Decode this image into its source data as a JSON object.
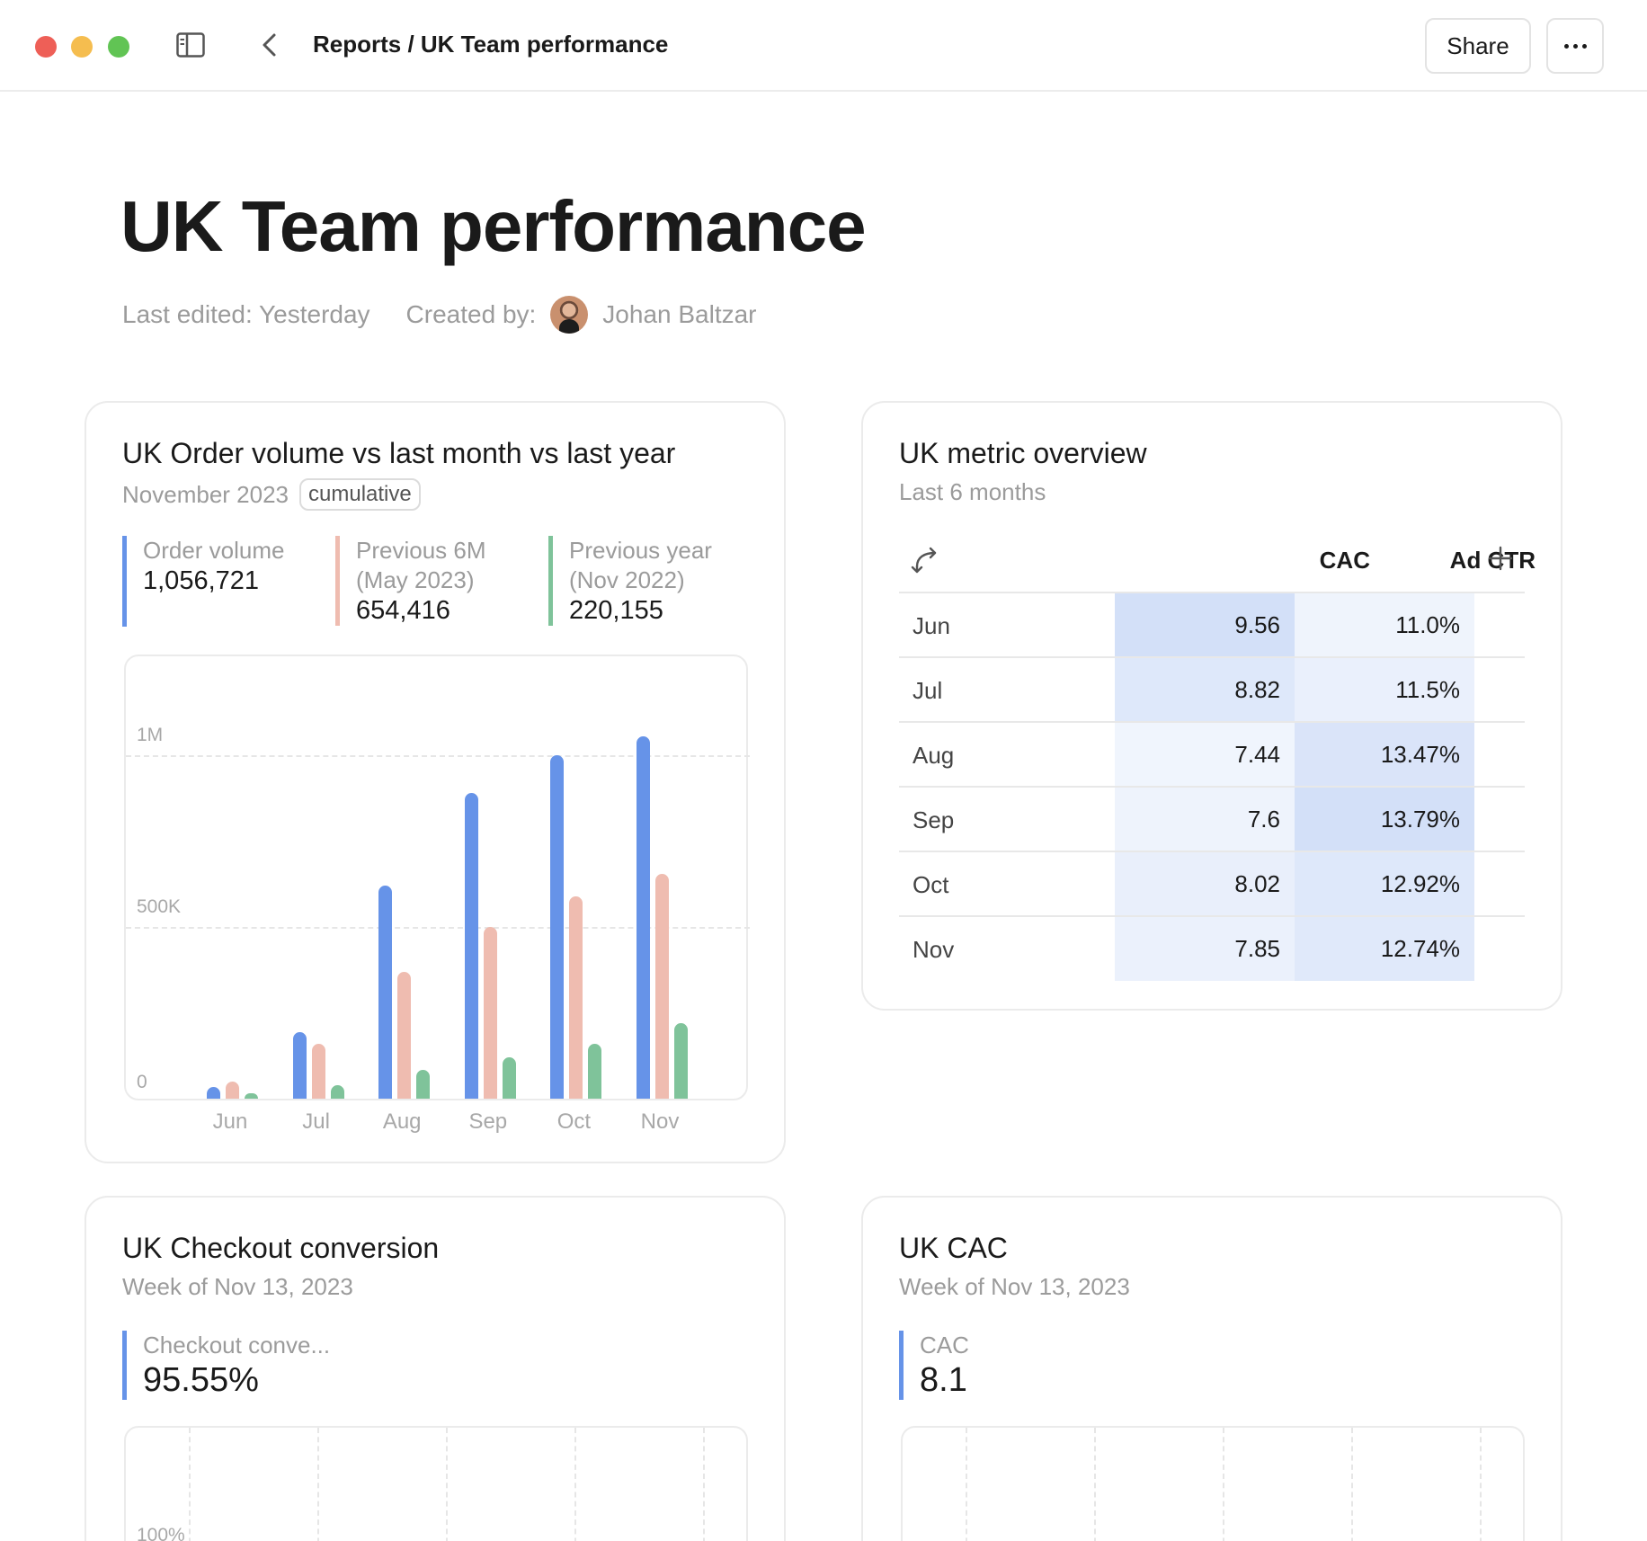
{
  "window": {
    "breadcrumb": "Reports / UK Team performance",
    "share_label": "Share",
    "icons": [
      "close-dot",
      "minimize-dot",
      "maximize-dot",
      "sidebar-toggle-icon",
      "chevron-left-icon",
      "ellipsis-icon"
    ]
  },
  "page": {
    "title": "UK Team performance",
    "last_edited": "Last edited: Yesterday",
    "created_by_label": "Created by:",
    "author": "Johan Baltzar"
  },
  "order_card": {
    "title": "UK Order volume vs last month vs last year",
    "subtitle": "November 2023",
    "badge": "cumulative",
    "kpis": [
      {
        "label": "Order volume",
        "value": "1,056,721",
        "color": "#6693e8"
      },
      {
        "label": "Previous 6M",
        "label2": "(May 2023)",
        "value": "654,416",
        "color": "#efbcb0"
      },
      {
        "label": "Previous year",
        "label2": "(Nov 2022)",
        "value": "220,155",
        "color": "#7fc39a"
      }
    ]
  },
  "chart_data": {
    "type": "bar",
    "categories": [
      "Jun",
      "Jul",
      "Aug",
      "Sep",
      "Oct",
      "Nov"
    ],
    "series": [
      {
        "values": [
          35000,
          195000,
          620000,
          890000,
          1000000,
          1056721
        ],
        "color": "#6693e8"
      },
      {
        "values": [
          50000,
          160000,
          370000,
          500000,
          590000,
          654416
        ],
        "color": "#efbcb0"
      },
      {
        "values": [
          15000,
          40000,
          85000,
          120000,
          160000,
          220155
        ],
        "color": "#7fc39a"
      }
    ],
    "ylim": [
      0,
      1200000
    ],
    "yticks": [
      {
        "value": 0,
        "label": "0"
      },
      {
        "value": 500000,
        "label": "500K"
      },
      {
        "value": 1000000,
        "label": "1M"
      }
    ],
    "grid": true
  },
  "metric_card": {
    "title": "UK metric overview",
    "subtitle": "Last 6 months",
    "columns": [
      "CAC",
      "Ad CTR"
    ],
    "rows": [
      {
        "month": "Jun",
        "cac": "9.56",
        "ctr": "11.0%",
        "cac_level": 0.62,
        "ctr_level": 0.1
      },
      {
        "month": "Jul",
        "cac": "8.82",
        "ctr": "11.5%",
        "cac_level": 0.42,
        "ctr_level": 0.2
      },
      {
        "month": "Aug",
        "cac": "7.44",
        "ctr": "13.47%",
        "cac_level": 0.08,
        "ctr_level": 0.5
      },
      {
        "month": "Sep",
        "cac": "7.6",
        "ctr": "13.79%",
        "cac_level": 0.12,
        "ctr_level": 0.62
      },
      {
        "month": "Oct",
        "cac": "8.02",
        "ctr": "12.92%",
        "cac_level": 0.22,
        "ctr_level": 0.42
      },
      {
        "month": "Nov",
        "cac": "7.85",
        "ctr": "12.74%",
        "cac_level": 0.18,
        "ctr_level": 0.38
      }
    ],
    "heat_color": "#7ea3ea"
  },
  "checkout_card": {
    "title": "UK Checkout conversion",
    "subtitle": "Week of Nov 13, 2023",
    "kpi_label": "Checkout conve...",
    "kpi_value": "95.55%",
    "ytick_top": "100%"
  },
  "cac_card": {
    "title": "UK CAC",
    "subtitle": "Week of Nov 13, 2023",
    "kpi_label": "CAC",
    "kpi_value": "8.1"
  }
}
